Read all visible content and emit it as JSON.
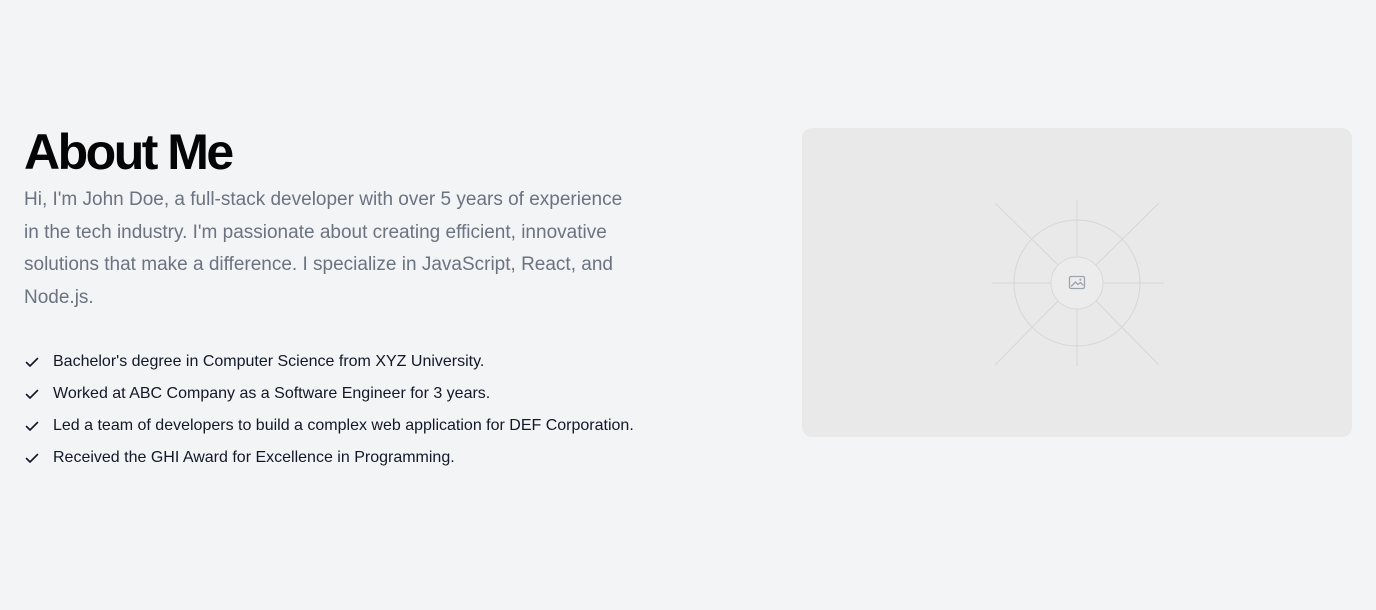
{
  "about": {
    "title": "About Me",
    "intro": "Hi, I'm John Doe, a full-stack developer with over 5 years of experience in the tech industry. I'm passionate about creating efficient, innovative solutions that make a difference. I specialize in JavaScript, React, and Node.js.",
    "highlights": [
      {
        "text": "Bachelor's degree in Computer Science from XYZ University.",
        "icon": "check-icon"
      },
      {
        "text": "Worked at ABC Company as a Software Engineer for 3 years.",
        "icon": "check-icon"
      },
      {
        "text": "Led a team of developers to build a complex web application for DEF Corporation.",
        "icon": "check-icon"
      },
      {
        "text": "Received the GHI Award for Excellence in Programming.",
        "icon": "check-icon"
      }
    ]
  },
  "media": {
    "placeholder_icon": "image-icon"
  },
  "colors": {
    "background": "#f3f4f6",
    "title": "#050505",
    "body_text": "#6b7280",
    "list_text": "#111827",
    "card_background": "#e9e9e9"
  }
}
